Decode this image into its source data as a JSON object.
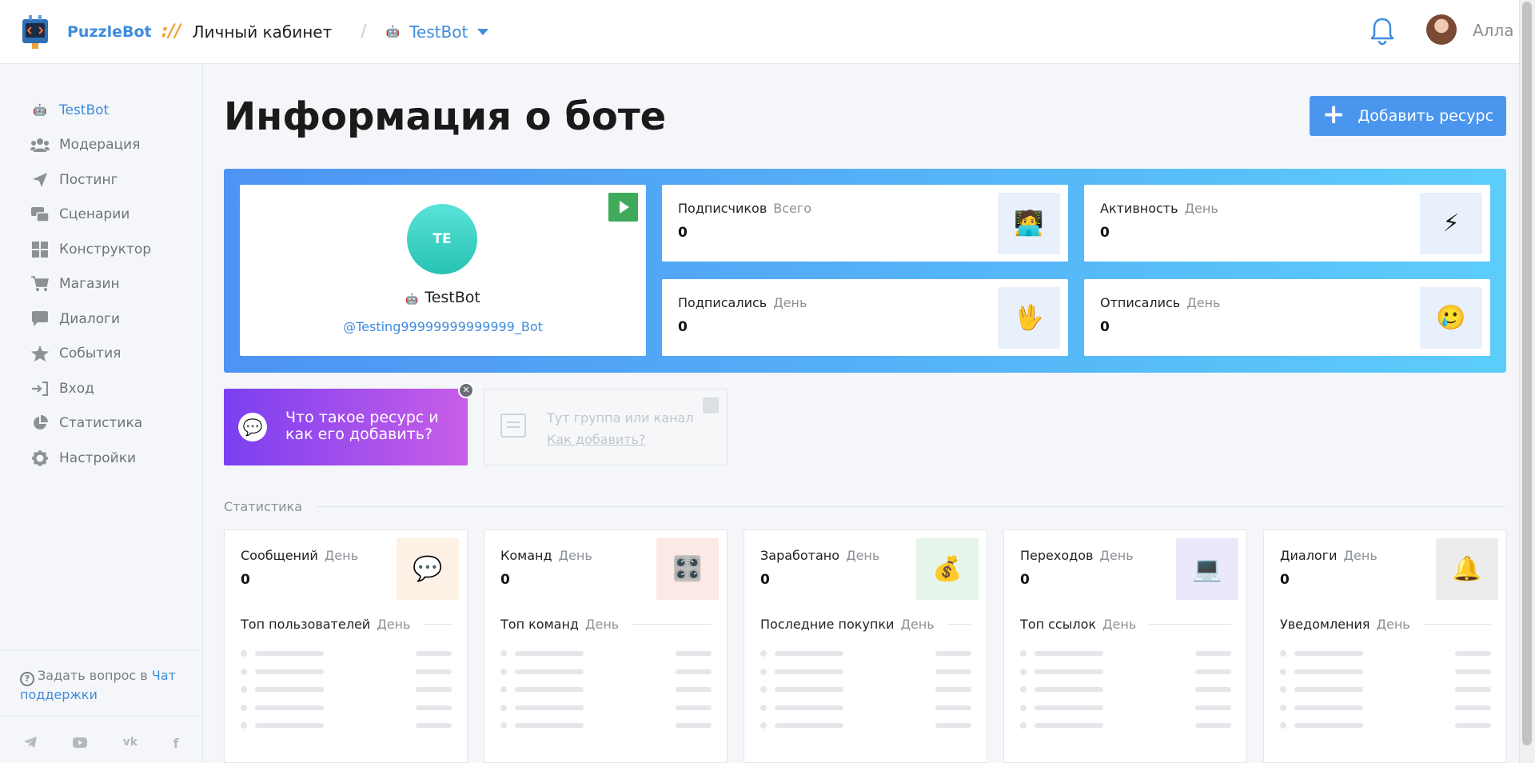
{
  "header": {
    "brand": "PuzzleBot",
    "brand_separator": "://",
    "cabinet": "Личный кабинет",
    "breadcrumb_separator": "/",
    "bot_selector": "TestBot",
    "user_name": "Алла"
  },
  "sidebar": {
    "items": [
      {
        "label": "TestBot",
        "icon": "robot-icon"
      },
      {
        "label": "Модерация",
        "icon": "users-icon"
      },
      {
        "label": "Постинг",
        "icon": "send-icon"
      },
      {
        "label": "Сценарии",
        "icon": "scenarios-icon"
      },
      {
        "label": "Конструктор",
        "icon": "grid-icon"
      },
      {
        "label": "Магазин",
        "icon": "cart-icon"
      },
      {
        "label": "Диалоги",
        "icon": "chat-icon"
      },
      {
        "label": "События",
        "icon": "star-icon"
      },
      {
        "label": "Вход",
        "icon": "login-icon"
      },
      {
        "label": "Статистика",
        "icon": "pie-chart-icon"
      },
      {
        "label": "Настройки",
        "icon": "gear-icon"
      }
    ],
    "support_text": "Задать вопрос в",
    "support_link": "Чат поддержки"
  },
  "main": {
    "title": "Информация о боте",
    "add_button": "Добавить ресурс",
    "bot": {
      "initials": "TE",
      "name": "TestBot",
      "username": "@Testing99999999999999_Bot"
    },
    "stats": [
      {
        "label": "Подписчиков",
        "period": "Всего",
        "value": "0",
        "icon": "🧑‍💻"
      },
      {
        "label": "Активность",
        "period": "День",
        "value": "0",
        "icon": "⚡"
      },
      {
        "label": "Подписались",
        "period": "День",
        "value": "0",
        "icon": "🖖"
      },
      {
        "label": "Отписались",
        "period": "День",
        "value": "0",
        "icon": "🥲"
      }
    ],
    "promo": {
      "line1": "Что такое ресурс и",
      "line2": "как его добавить?"
    },
    "placeholder": {
      "text": "Тут группа или канал",
      "link": "Как добавить?"
    },
    "section_label": "Статистика",
    "panels": [
      {
        "label": "Сообщений",
        "period": "День",
        "value": "0",
        "sub": "Топ пользователей",
        "sub_period": "День",
        "icon": "💬",
        "icon_bg": "#fdf1e6"
      },
      {
        "label": "Команд",
        "period": "День",
        "value": "0",
        "sub": "Топ команд",
        "sub_period": "День",
        "icon": "🎛️",
        "icon_bg": "#fce8e4"
      },
      {
        "label": "Заработано",
        "period": "День",
        "value": "0",
        "sub": "Последние покупки",
        "sub_period": "День",
        "icon": "💰",
        "icon_bg": "#e6f5ea"
      },
      {
        "label": "Переходов",
        "period": "День",
        "value": "0",
        "sub": "Топ ссылок",
        "sub_period": "День",
        "icon": "💻",
        "icon_bg": "#ebe8fb"
      },
      {
        "label": "Диалоги",
        "period": "День",
        "value": "0",
        "sub": "Уведомления",
        "sub_period": "День",
        "icon": "🔔",
        "icon_bg": "#ececec"
      }
    ]
  }
}
